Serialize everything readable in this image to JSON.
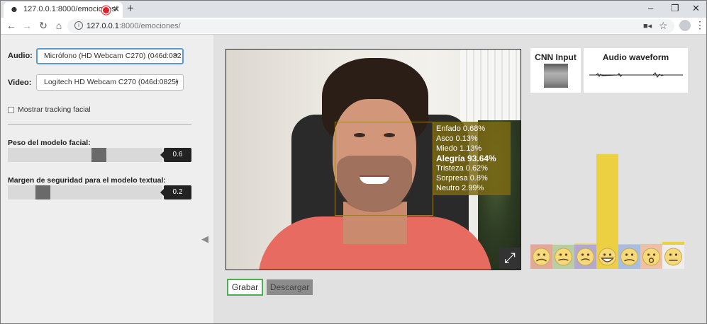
{
  "browser": {
    "tab_title": "127.0.0.1:8000/emociones/",
    "new_tab_glyph": "+",
    "url_host": "127.0.0.1",
    "url_rest": ":8000/emociones/",
    "nav_icons": [
      "back-arrow-icon",
      "forward-arrow-icon",
      "reload-icon",
      "home-icon"
    ],
    "window_controls": [
      "minimize-icon",
      "restore-icon",
      "close-icon"
    ]
  },
  "sidebar": {
    "audio_label": "Audio:",
    "audio_value": "Micrófono (HD Webcam C270) (046d:082",
    "video_label": "Video:",
    "video_value": "Logitech HD Webcam C270 (046d:0825)",
    "tracking_label": "Mostrar tracking facial",
    "tracking_checked": false,
    "slider1_title": "Peso del modelo facial:",
    "slider1_value": "0.6",
    "slider1_level": 0.6,
    "slider2_title": "Margen de seguridad para el modelo textual:",
    "slider2_value": "0.2",
    "slider2_level": 0.2
  },
  "video": {
    "emotions": [
      {
        "text": "Enfado 0.68%"
      },
      {
        "text": "Asco 0.13%"
      },
      {
        "text": "Miedo 1.13%"
      },
      {
        "text": "Alegría 93.64%"
      },
      {
        "text": "Tristeza 0.62%"
      },
      {
        "text": "Sorpresa 0.8%"
      },
      {
        "text": "Neutro 2.99%"
      }
    ]
  },
  "buttons": {
    "record": "Grabar",
    "download": "Descargar"
  },
  "cards": {
    "cnn_title": "CNN Input",
    "audio_title": "Audio waveform"
  },
  "chart_data": {
    "type": "bar",
    "categories": [
      "Enfado",
      "Asco",
      "Miedo",
      "Alegría",
      "Tristeza",
      "Sorpresa",
      "Neutro"
    ],
    "values": [
      0.68,
      0.13,
      1.13,
      93.64,
      0.62,
      0.8,
      2.99
    ],
    "colors": [
      "#e2a89a",
      "#b7cfa3",
      "#b3a9cf",
      "#ecd041",
      "#a9bedf",
      "#efc0a3",
      "#eeeeee"
    ],
    "icons": [
      "angry-emoji-icon",
      "disgust-emoji-icon",
      "fear-emoji-icon",
      "happy-emoji-icon",
      "sad-emoji-icon",
      "surprise-emoji-icon",
      "neutral-emoji-icon"
    ],
    "ylim": [
      0,
      100
    ]
  }
}
